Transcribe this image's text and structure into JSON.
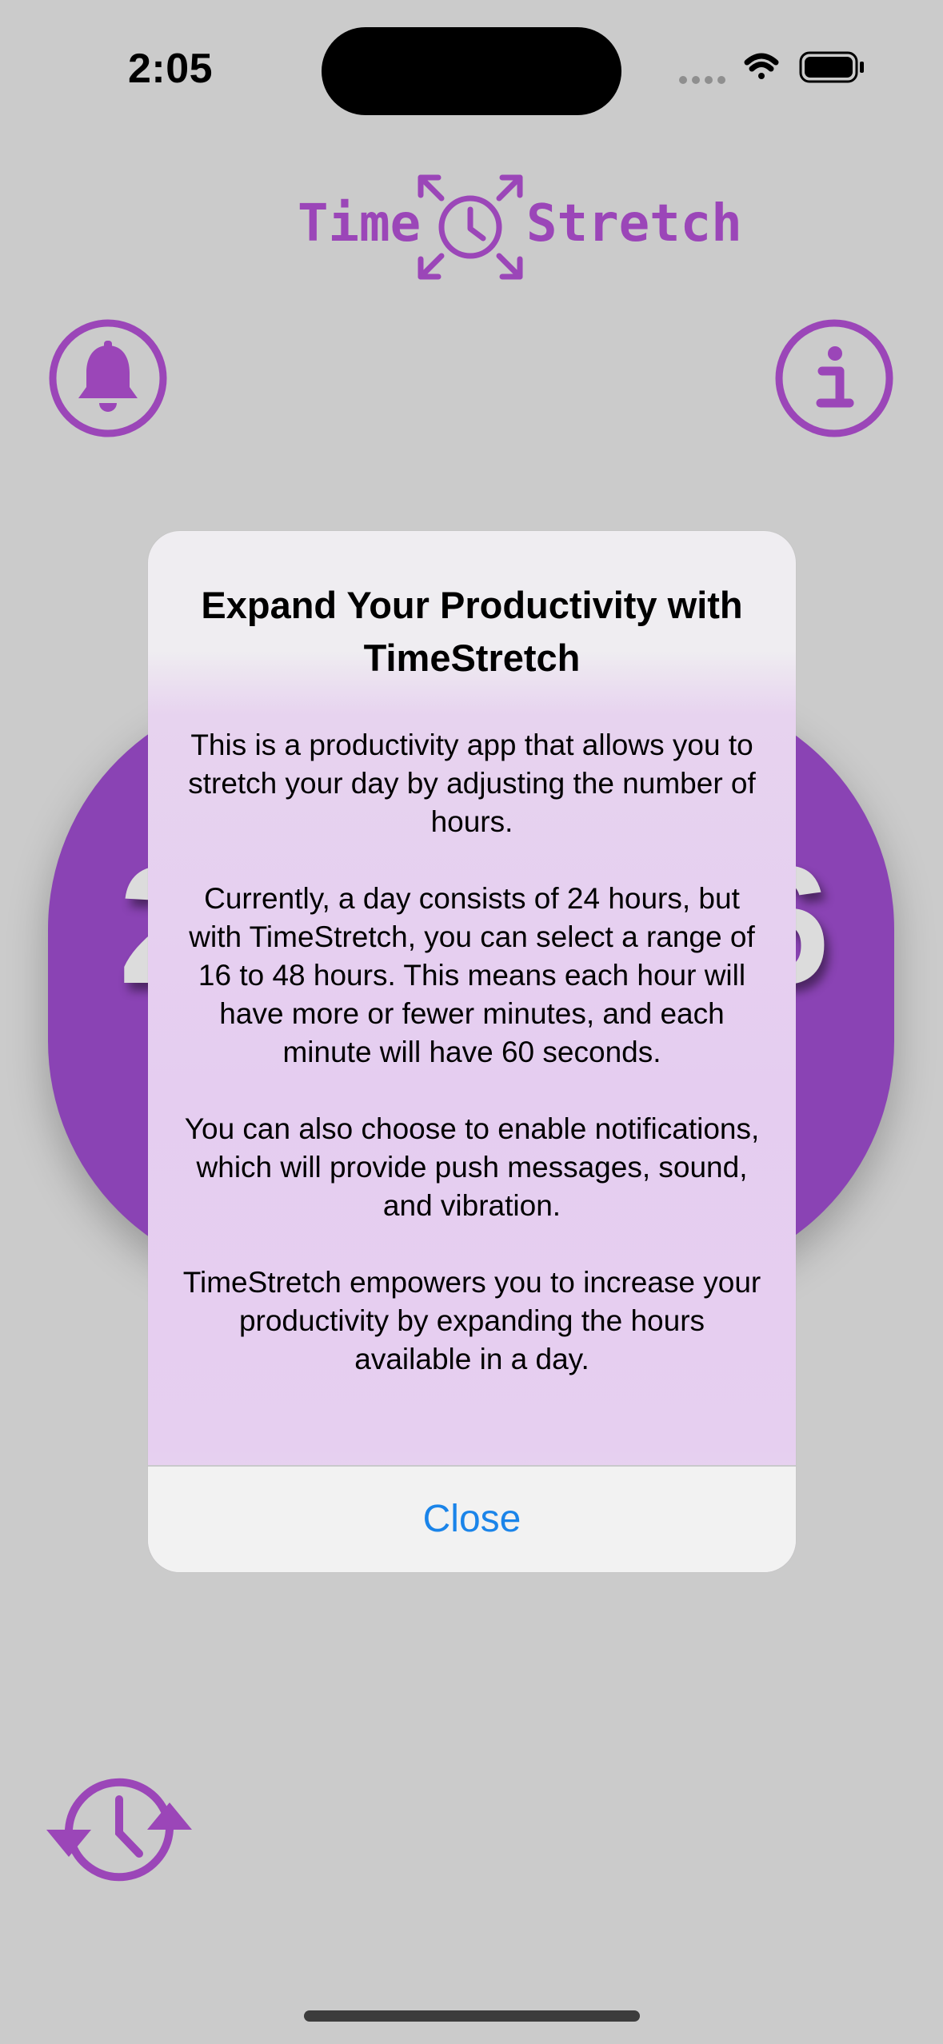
{
  "status_bar": {
    "time": "2:05",
    "icons": [
      "signal-dots-icon",
      "wifi-icon",
      "battery-icon"
    ]
  },
  "logo": {
    "left_text": "Time",
    "right_text": "Stretch",
    "icon": "clock-expand-icon"
  },
  "buttons": {
    "notifications": "bell-icon",
    "info": "info-icon",
    "history": "clock-arrows-icon"
  },
  "background_card": {
    "left_digit": "2",
    "right_digit": "6"
  },
  "alert": {
    "title": "Expand Your Productivity with TimeStretch",
    "paragraphs": [
      "This is a productivity app that allows you to stretch your day by adjusting the number of hours.",
      "Currently, a day consists of 24 hours, but with TimeStretch, you can select a range of 16 to 48 hours. This means each hour will have more or fewer minutes, and each minute will have 60 seconds.",
      "You can also choose to enable notifications, which will provide push messages, sound, and vibration.",
      "TimeStretch empowers you to increase your productivity by expanding the hours available in a day."
    ],
    "close_label": "Close"
  },
  "colors": {
    "accent_purple": "#9b46b8",
    "card_purple": "#8a43b4",
    "link_blue": "#1a84e9",
    "background": "#cbcbcb"
  }
}
